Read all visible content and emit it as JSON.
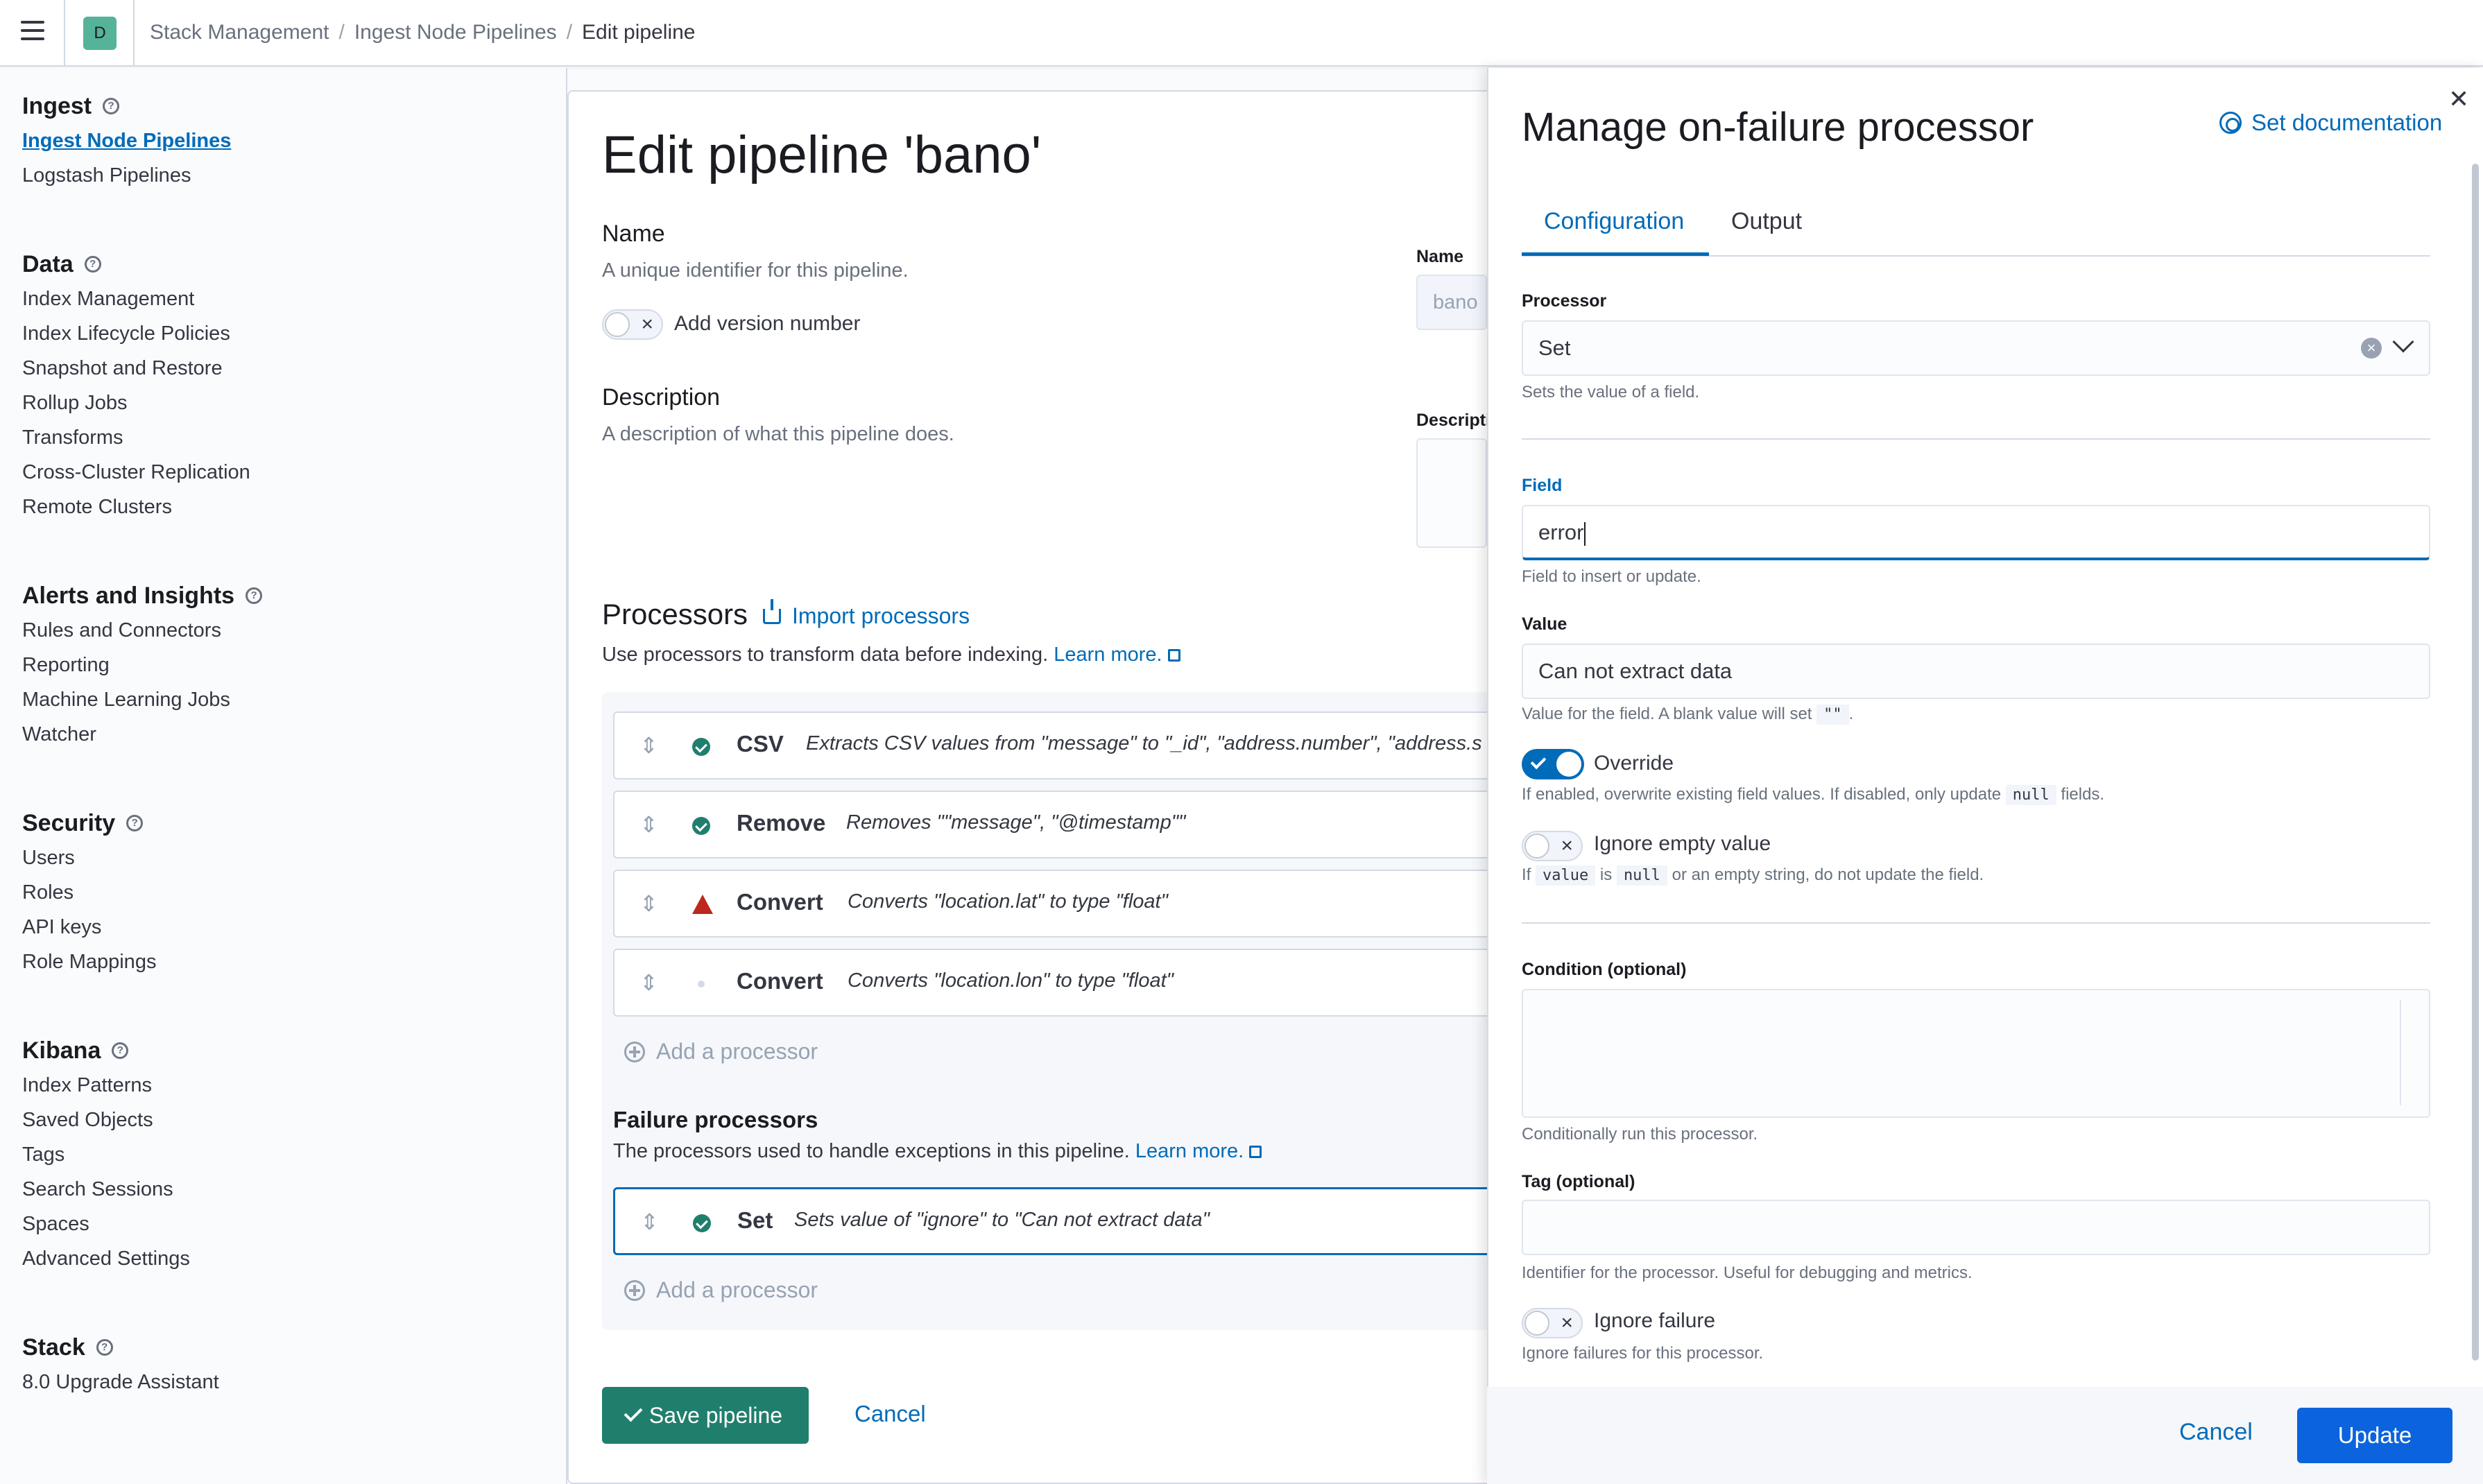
{
  "header": {
    "space_initial": "D",
    "breadcrumbs": [
      "Stack Management",
      "Ingest Node Pipelines",
      "Edit pipeline"
    ]
  },
  "sidebar": {
    "groups": [
      {
        "title": "Ingest",
        "items": [
          "Ingest Node Pipelines",
          "Logstash Pipelines"
        ]
      },
      {
        "title": "Data",
        "items": [
          "Index Management",
          "Index Lifecycle Policies",
          "Snapshot and Restore",
          "Rollup Jobs",
          "Transforms",
          "Cross-Cluster Replication",
          "Remote Clusters"
        ]
      },
      {
        "title": "Alerts and Insights",
        "items": [
          "Rules and Connectors",
          "Reporting",
          "Machine Learning Jobs",
          "Watcher"
        ]
      },
      {
        "title": "Security",
        "items": [
          "Users",
          "Roles",
          "API keys",
          "Role Mappings"
        ]
      },
      {
        "title": "Kibana",
        "items": [
          "Index Patterns",
          "Saved Objects",
          "Tags",
          "Search Sessions",
          "Spaces",
          "Advanced Settings"
        ]
      },
      {
        "title": "Stack",
        "items": [
          "8.0 Upgrade Assistant"
        ]
      }
    ]
  },
  "main": {
    "title": "Edit pipeline 'bano'",
    "name_section": {
      "title": "Name",
      "desc": "A unique identifier for this pipeline.",
      "toggle_label": "Add version number"
    },
    "description_section": {
      "title": "Description",
      "desc": "A description of what this pipeline does."
    },
    "right_fields": {
      "name_label": "Name",
      "name_value": "bano",
      "desc_label": "Descripti"
    },
    "processors": {
      "title": "Processors",
      "import_label": "Import processors",
      "desc": "Use processors to transform data before indexing.",
      "learn_more": "Learn more.",
      "rows": [
        {
          "name": "CSV",
          "desc": "Extracts CSV values from \"message\" to \"_id\", \"address.number\", \"address.s",
          "status": "ok"
        },
        {
          "name": "Remove",
          "desc": "Removes \"\"message\", \"@timestamp\"\"",
          "status": "ok"
        },
        {
          "name": "Convert",
          "desc": "Converts \"location.lat\" to type \"float\"",
          "status": "warning"
        },
        {
          "name": "Convert",
          "desc": "Converts \"location.lon\" to type \"float\"",
          "status": "none"
        }
      ],
      "add_label": "Add a processor"
    },
    "failure": {
      "title": "Failure processors",
      "desc": "The processors used to handle exceptions in this pipeline.",
      "learn_more": "Learn more.",
      "rows": [
        {
          "name": "Set",
          "desc": "Sets value of \"ignore\" to \"Can not extract data\"",
          "status": "ok"
        }
      ],
      "add_label": "Add a processor"
    },
    "save_label": "Save pipeline",
    "cancel_label": "Cancel"
  },
  "flyout": {
    "title": "Manage on-failure processor",
    "doc_link": "Set documentation",
    "tabs": [
      "Configuration",
      "Output"
    ],
    "processor": {
      "label": "Processor",
      "value": "Set",
      "help": "Sets the value of a field."
    },
    "field": {
      "label": "Field",
      "value": "error",
      "help": "Field to insert or update."
    },
    "value": {
      "label": "Value",
      "value": "Can not extract data",
      "help_pre": "Value for the field. A blank value will set",
      "help_code": "\"\"",
      "help_post": "."
    },
    "override": {
      "label": "Override",
      "help_pre": "If enabled, overwrite existing field values. If disabled, only update",
      "help_code": "null",
      "help_post": "fields."
    },
    "ignore_empty": {
      "label": "Ignore empty value",
      "help_if": "If",
      "help_code1": "value",
      "help_is": "is",
      "help_code2": "null",
      "help_post": "or an empty string, do not update the field."
    },
    "condition": {
      "label": "Condition (optional)",
      "help": "Conditionally run this processor."
    },
    "tag": {
      "label": "Tag (optional)",
      "help": "Identifier for the processor. Useful for debugging and metrics."
    },
    "ignore_failure": {
      "label": "Ignore failure",
      "help": "Ignore failures for this processor."
    },
    "cancel_label": "Cancel",
    "update_label": "Update"
  }
}
